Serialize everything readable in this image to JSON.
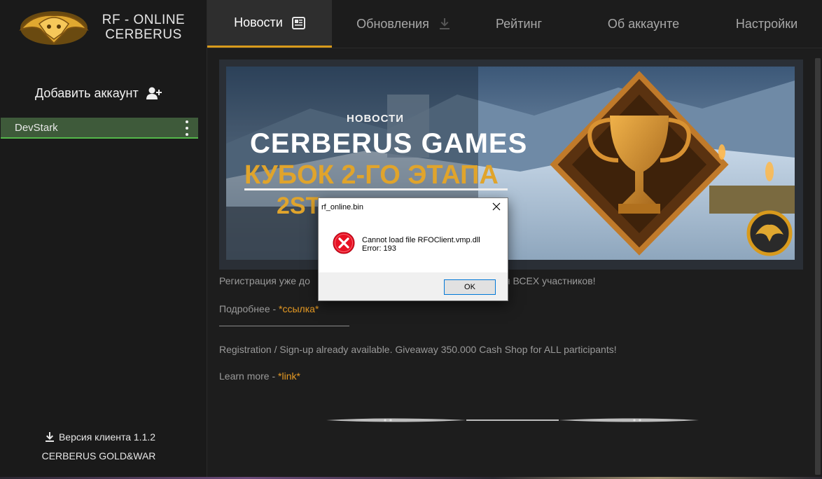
{
  "app": {
    "brand_line1": "RF - ONLINE",
    "brand_line2": "CERBERUS"
  },
  "sidebar": {
    "add_account_label": "Добавить аккаунт",
    "account_name": "DevStark",
    "version_label": "Версия клиента 1.1.2",
    "guild_label": "CERBERUS GOLD&WAR"
  },
  "nav": {
    "tabs": [
      {
        "label": "Новости",
        "active": true
      },
      {
        "label": "Обновления",
        "active": false
      },
      {
        "label": "Рейтинг",
        "active": false
      },
      {
        "label": "Об аккаунте",
        "active": false
      },
      {
        "label": "Настройки",
        "active": false
      }
    ]
  },
  "news": {
    "banner_tag": "НОВОСТИ",
    "banner_title": "CERBERUS GAMES",
    "banner_subtitle": "КУБОК 2-ГО ЭТАПА",
    "banner_subtitle2": "2ST",
    "ru_text_left": "Регистрация уже до",
    "ru_text_right": "ля ВСЕХ участников!",
    "ru_more_label": "Подробнее - ",
    "ru_more_link": "*ссылка*",
    "en_text": "Registration / Sign-up already available. Giveaway 350.000 Cash Shop for ALL participants!",
    "en_more_label": "Learn more - ",
    "en_more_link": "*link*"
  },
  "dialog": {
    "title": "rf_online.bin",
    "message_line1": "Cannot load file RFOClient.vmp.dll",
    "message_line2": "Error: 193",
    "ok_label": "OK"
  },
  "colors": {
    "accent": "#d89a1c",
    "active_account_bg": "#3e5a3a",
    "active_account_border": "#54b84a",
    "link": "#e69a23",
    "error_icon": "#e81123"
  }
}
